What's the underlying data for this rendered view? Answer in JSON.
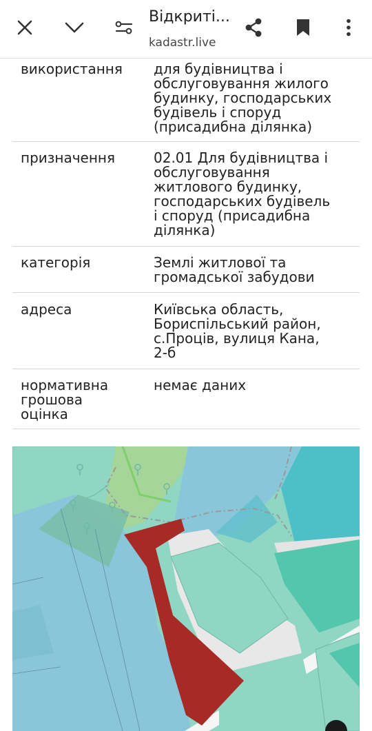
{
  "browser": {
    "title": "Відкриті...",
    "url": "kadastr.live",
    "icons": [
      "close-icon",
      "chevron-down-icon",
      "page-settings-icon",
      "share-icon",
      "bookmark-icon",
      "more-vert-icon"
    ]
  },
  "rows": [
    {
      "key": "використання",
      "value": [
        "для будівництва і",
        "обслуговування жилого",
        "будинку, господарських",
        "будівель і споруд",
        "(присадибна ділянка)"
      ]
    },
    {
      "key": "призначення",
      "value": [
        "02.01 Для будівництва і",
        "обслуговування",
        "житлового будинку,",
        "господарських будівель",
        "і споруд (присадибна",
        "ділянка)"
      ]
    },
    {
      "key": "категорія",
      "value": [
        "Землі житлової та",
        "громадської забудови"
      ]
    },
    {
      "key": "адреса",
      "value": [
        "Київська область,",
        "Бориспільський район,",
        "с.Проців, вулиця Кана,",
        "2-б"
      ]
    },
    {
      "key": "нормативна\nгрошова\nоцінка",
      "value": [
        "немає даних"
      ]
    }
  ],
  "map": {
    "colors": {
      "teal": "#8fd6c3",
      "blue": "#8ac6d9",
      "deep_teal": "#4cc0c6",
      "green": "#a6d59a",
      "parcel": "#a72a27",
      "road": "#e8e8e8"
    },
    "selected_parcel": "selected-parcel"
  }
}
